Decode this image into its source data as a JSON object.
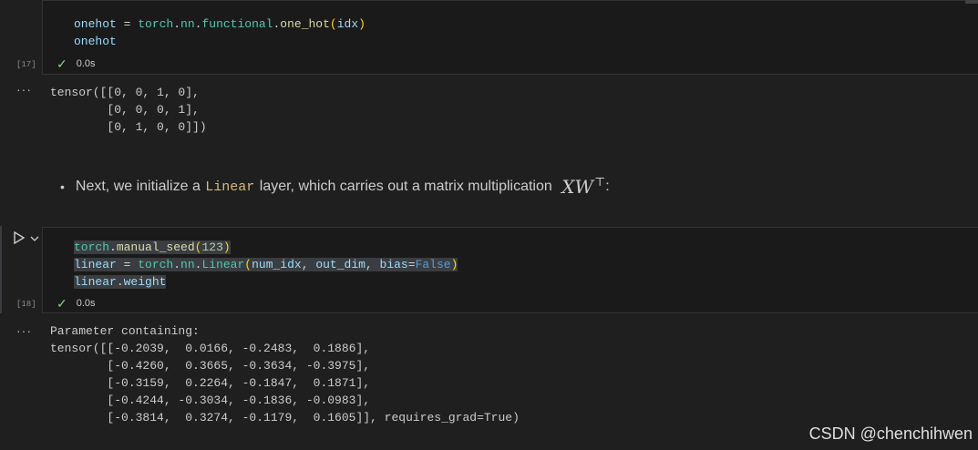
{
  "cell17": {
    "lines": [
      [
        {
          "t": "onehot",
          "c": "var"
        },
        {
          "t": " = ",
          "c": "op"
        },
        {
          "t": "torch",
          "c": "mod"
        },
        {
          "t": ".",
          "c": "op"
        },
        {
          "t": "nn",
          "c": "mod"
        },
        {
          "t": ".",
          "c": "op"
        },
        {
          "t": "functional",
          "c": "mod"
        },
        {
          "t": ".",
          "c": "op"
        },
        {
          "t": "one_hot",
          "c": "fn"
        },
        {
          "t": "(",
          "c": "br"
        },
        {
          "t": "idx",
          "c": "var"
        },
        {
          "t": ")",
          "c": "br"
        }
      ],
      [
        {
          "t": "onehot",
          "c": "var"
        }
      ]
    ],
    "exec_count": "[17]",
    "status_time": "0.0s"
  },
  "output17": {
    "dots": "···",
    "text": "tensor([[0, 0, 1, 0],\n        [0, 0, 0, 1],\n        [0, 1, 0, 0]])"
  },
  "markdown": {
    "bullet": "•",
    "text_before": "Next, we initialize a ",
    "code": "Linear",
    "text_after": " layer, which carries out a matrix multiplication ",
    "math": "XW",
    "sup": "⊤",
    "tail": ":"
  },
  "cell18": {
    "lines": [
      [
        {
          "t": "torch",
          "c": "mod"
        },
        {
          "t": ".",
          "c": "op"
        },
        {
          "t": "manual_seed",
          "c": "fn"
        },
        {
          "t": "(",
          "c": "br"
        },
        {
          "t": "123",
          "c": "num"
        },
        {
          "t": ")",
          "c": "br"
        }
      ],
      [
        {
          "t": "linear",
          "c": "var"
        },
        {
          "t": " = ",
          "c": "op"
        },
        {
          "t": "torch",
          "c": "mod"
        },
        {
          "t": ".",
          "c": "op"
        },
        {
          "t": "nn",
          "c": "mod"
        },
        {
          "t": ".",
          "c": "op"
        },
        {
          "t": "Linear",
          "c": "mod"
        },
        {
          "t": "(",
          "c": "br"
        },
        {
          "t": "num_idx",
          "c": "var"
        },
        {
          "t": ", ",
          "c": "op"
        },
        {
          "t": "out_dim",
          "c": "var"
        },
        {
          "t": ", ",
          "c": "op"
        },
        {
          "t": "bias",
          "c": "var"
        },
        {
          "t": "=",
          "c": "op"
        },
        {
          "t": "False",
          "c": "const"
        },
        {
          "t": ")",
          "c": "br"
        }
      ],
      [
        {
          "t": "linear",
          "c": "var"
        },
        {
          "t": ".",
          "c": "op"
        },
        {
          "t": "weight",
          "c": "var"
        }
      ]
    ],
    "exec_count": "[18]",
    "status_time": "0.0s"
  },
  "output18": {
    "dots": "···",
    "text": "Parameter containing:\ntensor([[-0.2039,  0.0166, -0.2483,  0.1886],\n        [-0.4260,  0.3665, -0.3634, -0.3975],\n        [-0.3159,  0.2264, -0.1847,  0.1871],\n        [-0.4244, -0.3034, -0.1836, -0.0983],\n        [-0.3814,  0.3274, -0.1179,  0.1605]], requires_grad=True)"
  },
  "icons": {
    "run": "run-triangle-icon",
    "chevron": "chevron-down-icon",
    "check": "check-icon"
  },
  "watermark": "CSDN @chenchihwen"
}
